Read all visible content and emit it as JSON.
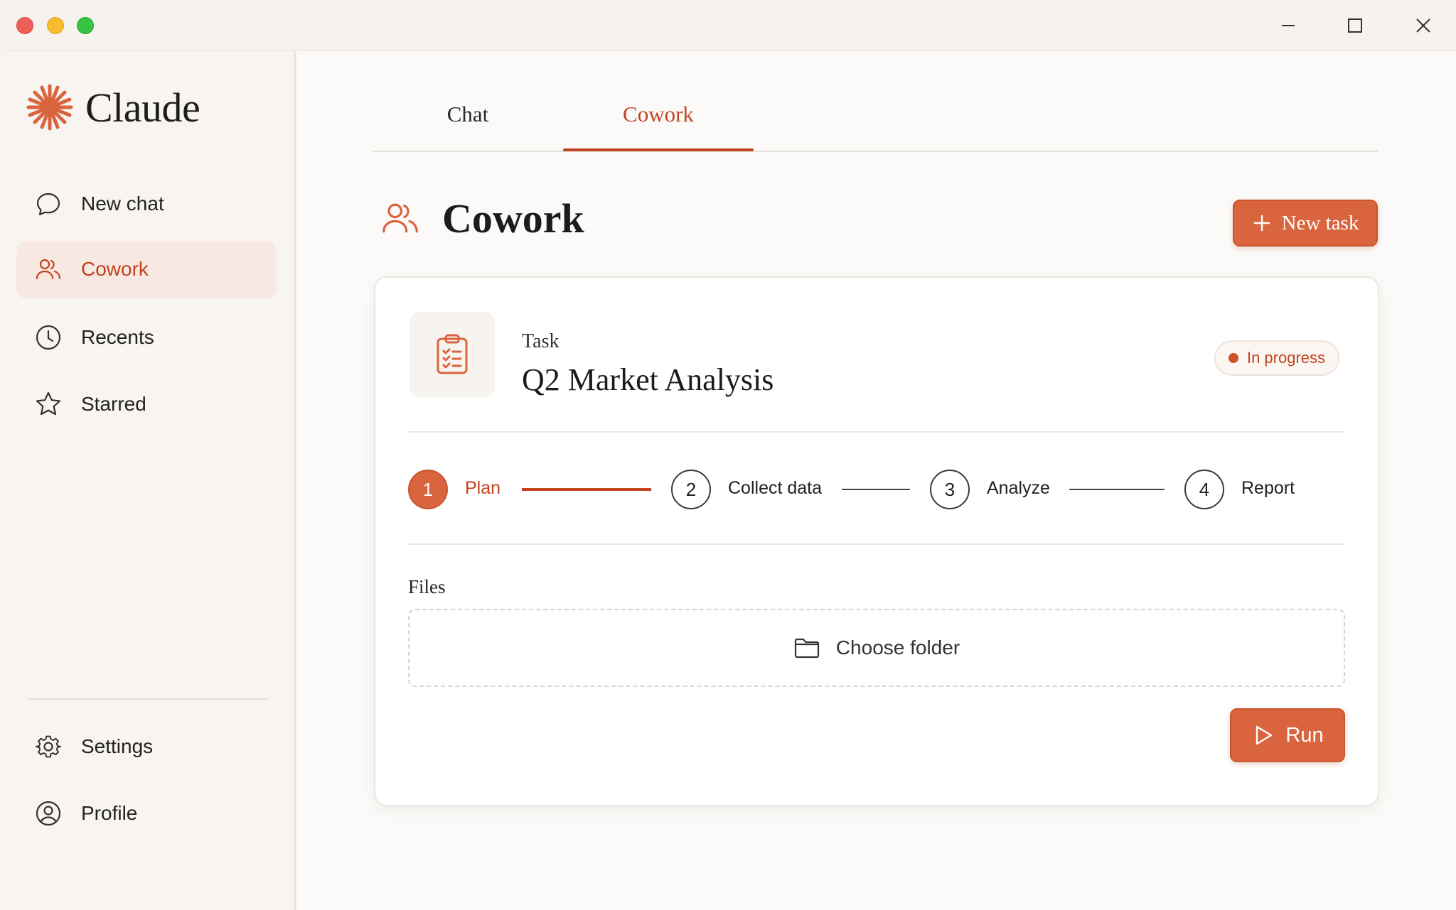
{
  "app": {
    "name": "Claude"
  },
  "sidebar": {
    "items": [
      {
        "label": "New chat",
        "icon": "chat-bubble-icon"
      },
      {
        "label": "Cowork",
        "icon": "people-icon",
        "active": true
      },
      {
        "label": "Recents",
        "icon": "clock-icon"
      },
      {
        "label": "Starred",
        "icon": "star-icon"
      }
    ],
    "footer_items": [
      {
        "label": "Settings",
        "icon": "gear-icon"
      },
      {
        "label": "Profile",
        "icon": "user-circle-icon"
      }
    ]
  },
  "tabs": [
    {
      "label": "Chat",
      "active": false
    },
    {
      "label": "Cowork",
      "active": true
    }
  ],
  "header": {
    "title": "Cowork",
    "new_task_label": "New task"
  },
  "task": {
    "kicker": "Task",
    "title": "Q2 Market Analysis",
    "status": "In progress",
    "steps": [
      {
        "number": "1",
        "label": "Plan",
        "active": true
      },
      {
        "number": "2",
        "label": "Collect data",
        "active": false
      },
      {
        "number": "3",
        "label": "Analyze",
        "active": false
      },
      {
        "number": "4",
        "label": "Report",
        "active": false
      }
    ],
    "files_label": "Files",
    "choose_folder_label": "Choose folder",
    "run_label": "Run"
  },
  "colors": {
    "accent": "#d9643d",
    "accent_text": "#c2431f",
    "active_nav_bg": "#f7e9e2"
  }
}
